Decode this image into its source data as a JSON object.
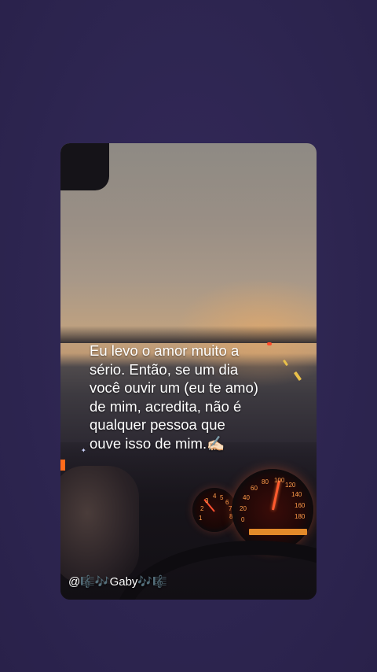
{
  "post": {
    "quote": "Eu levo o amor muito a\nsério. Então, se um dia\nvocê ouvir um (eu te amo)\nde mim, acredita, não é\nqualquer pessoa que\nouve isso de mim.✍🏻",
    "watermark": "@🎼🎶Gaby🎶🎼"
  },
  "speedometer": {
    "ticks": [
      "20",
      "40",
      "60",
      "80",
      "100",
      "120",
      "140",
      "160",
      "180",
      "0"
    ]
  },
  "tachometer": {
    "ticks": [
      "1",
      "2",
      "3",
      "4",
      "5",
      "6",
      "7",
      "8"
    ]
  },
  "colors": {
    "background": "#2f2650",
    "gauge_accent": "#ff5a2e",
    "text": "#ffffff"
  }
}
